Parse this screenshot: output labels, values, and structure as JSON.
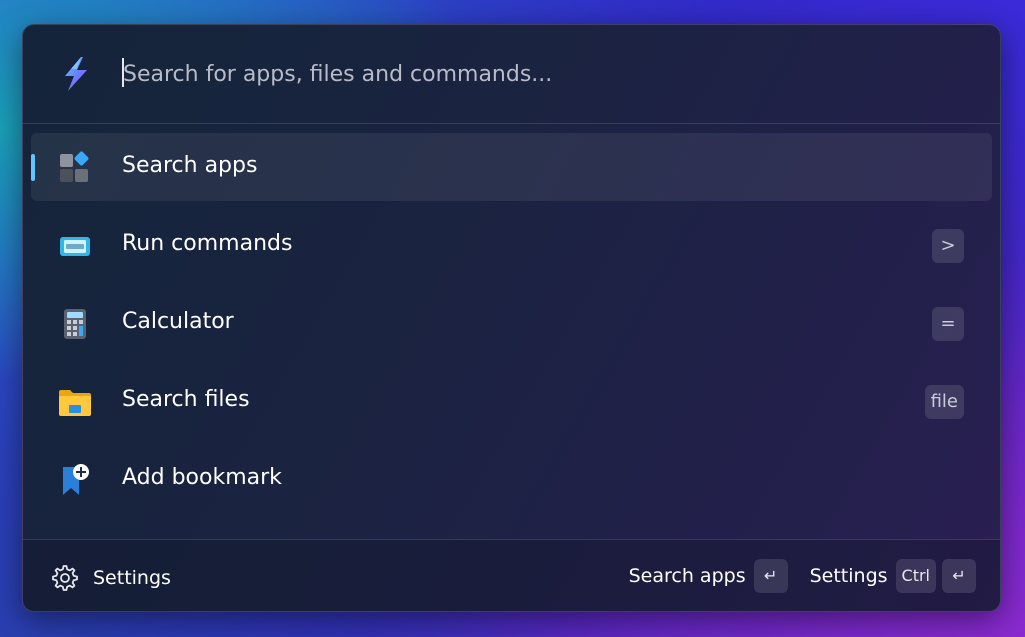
{
  "search": {
    "placeholder": "Search for apps, files and commands..."
  },
  "items": [
    {
      "label": "Search apps",
      "shortcut": "",
      "icon": "apps-icon",
      "selected": true
    },
    {
      "label": "Run commands",
      "shortcut": ">",
      "icon": "terminal-icon"
    },
    {
      "label": "Calculator",
      "shortcut": "=",
      "icon": "calculator-icon"
    },
    {
      "label": "Search files",
      "shortcut": "file",
      "icon": "folder-icon"
    },
    {
      "label": "Add bookmark",
      "shortcut": "",
      "icon": "bookmark-add-icon"
    }
  ],
  "footer": {
    "settings_label": "Settings",
    "action1_label": "Search apps",
    "action2_label": "Settings",
    "ctrl_key": "Ctrl",
    "enter_glyph": "↵"
  },
  "colors": {
    "accent": "#62c4ff"
  }
}
